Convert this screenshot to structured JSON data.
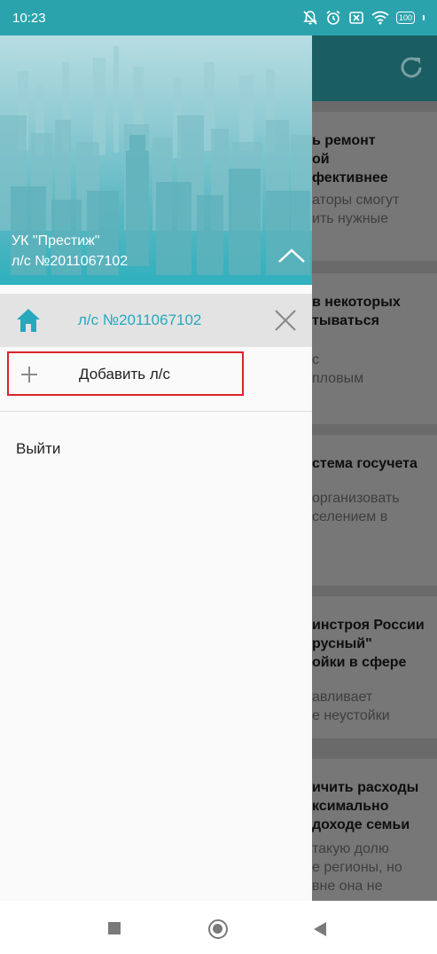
{
  "status": {
    "time": "10:23",
    "battery": "100",
    "icons": [
      "bell-off-icon",
      "alarm-icon",
      "sim-off-icon",
      "wifi-icon",
      "battery-icon"
    ]
  },
  "background_feed": {
    "cards": [
      {
        "title_lines": [
          "ь ремонт",
          "ой",
          "фективнее"
        ],
        "text_lines": [
          "аторы смогут",
          "ить нужные"
        ]
      },
      {
        "title_lines": [
          "в некоторых",
          "тываться"
        ],
        "text_lines": [
          "с",
          "пловым"
        ]
      },
      {
        "title_lines": [
          "стема госучета"
        ],
        "text_lines": [
          "организовать",
          "селением в"
        ]
      },
      {
        "title_lines": [
          "инстроя России",
          "русный\"",
          "ойки в сфере"
        ],
        "text_lines": [
          "авливает",
          "е неустойки"
        ]
      },
      {
        "title_lines": [
          "ичить расходы",
          "ксимально",
          "доходе семьи"
        ],
        "text_lines": [
          "такую долю",
          "е регионы, но",
          "вне она не"
        ]
      }
    ]
  },
  "drawer": {
    "header": {
      "organization": "УК \"Престиж\"",
      "account": "л/с №2011067102"
    },
    "account_item": {
      "label": "л/с №2011067102"
    },
    "add_account": {
      "label": "Добавить л/с"
    },
    "logout": {
      "label": "Выйти"
    }
  },
  "colors": {
    "accent": "#26a9bd",
    "status_bar": "#2aa3ad",
    "highlight_border": "#d8242b"
  }
}
